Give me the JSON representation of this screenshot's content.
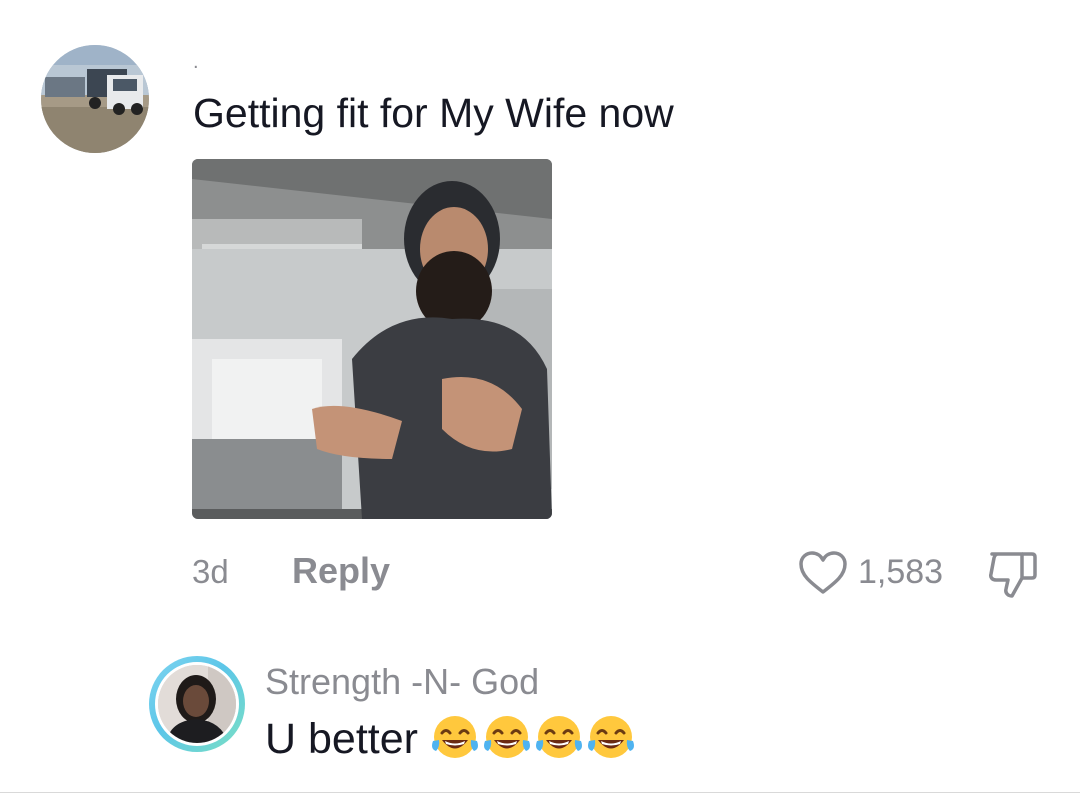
{
  "comment": {
    "username": ".",
    "text": "Getting fit for My Wife now",
    "age": "3d",
    "reply_label": "Reply",
    "like_count": "1,583"
  },
  "reply_comment": {
    "username": "Strength -N- God",
    "text": "U better",
    "emoji_icons": [
      "face-with-tears-of-joy-icon",
      "face-with-tears-of-joy-icon",
      "face-with-tears-of-joy-icon",
      "face-with-tears-of-joy-icon"
    ]
  },
  "colors": {
    "primary_text": "#161823",
    "secondary_text": "#8a8b91",
    "story_ring": "#5cc6e8"
  }
}
